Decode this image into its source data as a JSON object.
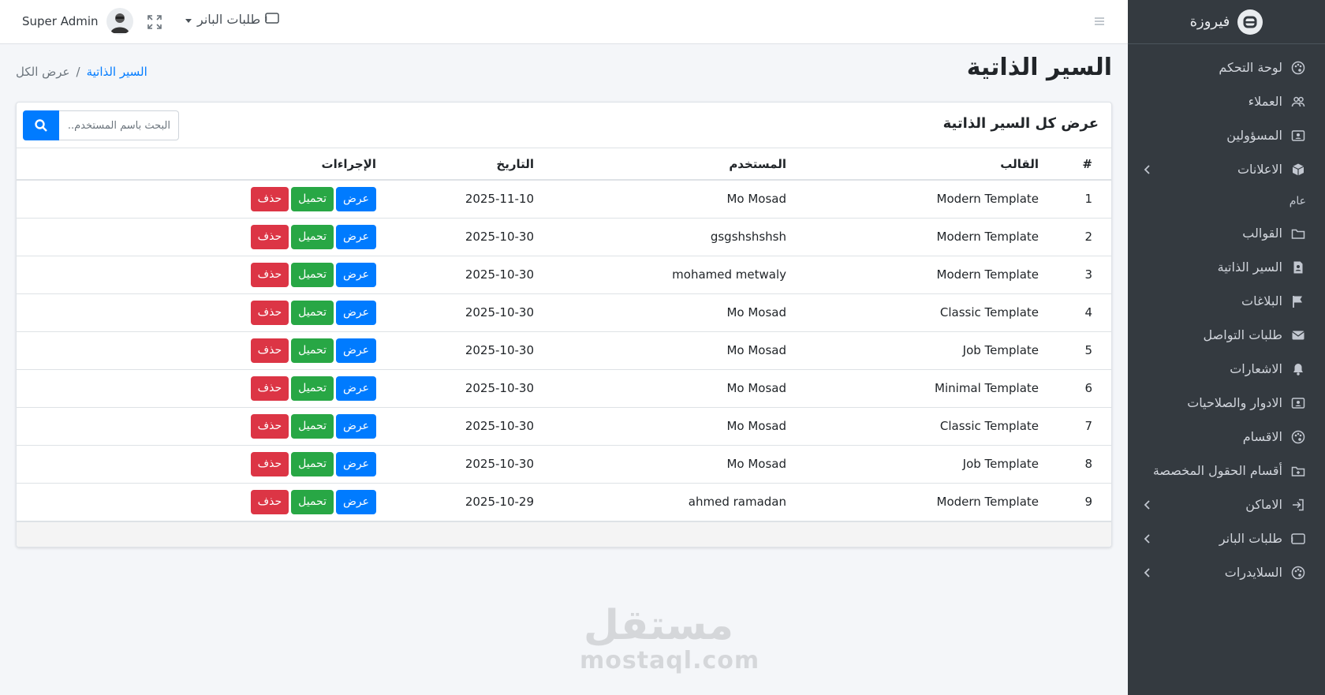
{
  "sidebar": {
    "brand": "فيروزة",
    "items": [
      {
        "label": "لوحة التحكم",
        "icon": "palette-icon",
        "arrow": false
      },
      {
        "label": "العملاء",
        "icon": "users-icon",
        "arrow": false
      },
      {
        "label": "المسؤولين",
        "icon": "id-card-icon",
        "arrow": false
      },
      {
        "label": "الاعلانات",
        "icon": "box-icon",
        "arrow": true
      }
    ],
    "section_header": "عام",
    "items2": [
      {
        "label": "القوالب",
        "icon": "folder-icon",
        "arrow": false
      },
      {
        "label": "السير الذاتية",
        "icon": "file-user-icon",
        "arrow": false
      },
      {
        "label": "البلاغات",
        "icon": "flag-icon",
        "arrow": false
      },
      {
        "label": "طلبات التواصل",
        "icon": "envelope-icon",
        "arrow": false
      },
      {
        "label": "الاشعارات",
        "icon": "bell-icon",
        "arrow": false
      },
      {
        "label": "الادوار والصلاحيات",
        "icon": "id-card-icon",
        "arrow": false
      },
      {
        "label": "الاقسام",
        "icon": "palette-icon",
        "arrow": false
      },
      {
        "label": "أقسام الحقول المخصصة",
        "icon": "folder-plus-icon",
        "arrow": false
      },
      {
        "label": "الاماكن",
        "icon": "sign-in-icon",
        "arrow": true
      },
      {
        "label": "طلبات البانر",
        "icon": "ad-icon",
        "arrow": true
      },
      {
        "label": "السلايدرات",
        "icon": "palette-icon",
        "arrow": true
      }
    ]
  },
  "topbar": {
    "user_name": "Super Admin",
    "banner_menu": "طلبات البانر"
  },
  "page": {
    "title": "السير الذاتية",
    "breadcrumb_link": "السير الذاتية",
    "breadcrumb_sep": "/",
    "breadcrumb_current": "عرض الكل"
  },
  "card": {
    "title": "عرض كل السير الذاتية",
    "search_placeholder": "البحث باسم المستخدم..."
  },
  "table": {
    "headers": [
      "#",
      "القالب",
      "المستخدم",
      "التاريخ",
      "الإجراءات"
    ],
    "actions": {
      "view": "عرض",
      "download": "تحميل",
      "delete": "حذف"
    },
    "rows": [
      [
        "1",
        "Modern Template",
        "Mo Mosad",
        "2025-11-10"
      ],
      [
        "2",
        "Modern Template",
        "gsgshshshsh",
        "2025-10-30"
      ],
      [
        "3",
        "Modern Template",
        "mohamed metwaly",
        "2025-10-30"
      ],
      [
        "4",
        "Classic Template",
        "Mo Mosad",
        "2025-10-30"
      ],
      [
        "5",
        "Job Template",
        "Mo Mosad",
        "2025-10-30"
      ],
      [
        "6",
        "Minimal Template",
        "Mo Mosad",
        "2025-10-30"
      ],
      [
        "7",
        "Classic Template",
        "Mo Mosad",
        "2025-10-30"
      ],
      [
        "8",
        "Job Template",
        "Mo Mosad",
        "2025-10-30"
      ],
      [
        "9",
        "Modern Template",
        "ahmed ramadan",
        "2025-10-29"
      ]
    ]
  },
  "watermark": {
    "arabic": "مستقل",
    "latin": "mostaql.com"
  },
  "colors": {
    "sidebar_bg": "#343a40",
    "primary": "#007bff",
    "success": "#28a745",
    "danger": "#dc3545",
    "content_bg": "#f4f6f9"
  }
}
